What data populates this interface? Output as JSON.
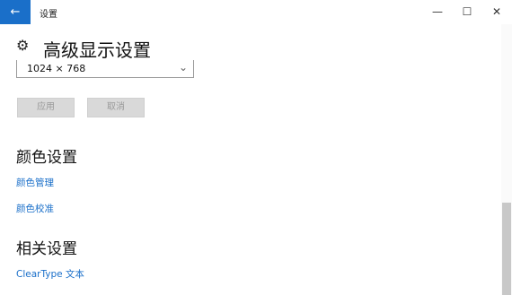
{
  "window": {
    "title": "设置",
    "back_icon": "←",
    "min_icon": "—",
    "max_icon": "☐",
    "close_icon": "✕"
  },
  "header": {
    "gear_icon": "⚙",
    "title": "高级显示设置"
  },
  "resolution": {
    "value": "1024 × 768",
    "chevron": "⌄"
  },
  "buttons": {
    "apply": "应用",
    "cancel": "取消"
  },
  "color_section": {
    "title": "颜色设置",
    "links": [
      "颜色管理",
      "颜色校准"
    ]
  },
  "related_section": {
    "title": "相关设置",
    "links": [
      "ClearType 文本"
    ]
  },
  "colors": {
    "accent": "#1a6fc9",
    "button_bg": "#d9d9d9"
  }
}
